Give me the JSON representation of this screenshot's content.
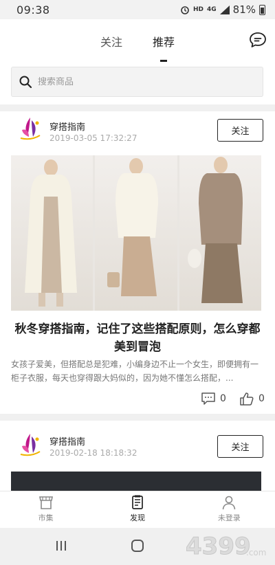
{
  "status_bar": {
    "time": "09:38",
    "network_label": "HD",
    "signal_label": "4G",
    "battery_text": "81%"
  },
  "header": {
    "tabs": [
      {
        "label": "关注",
        "active": false
      },
      {
        "label": "推荐",
        "active": true
      }
    ],
    "message_icon": "chat-bubble-icon"
  },
  "search": {
    "placeholder": "搜索商品"
  },
  "posts": [
    {
      "author": "穿搭指南",
      "timestamp": "2019-03-05 17:32:27",
      "follow_label": "关注",
      "title": "秋冬穿搭指南，记住了这些搭配原则，怎么穿都美到冒泡",
      "excerpt": "女孩子爱美，但搭配总是犯难，小编身边不止一个女生，即便拥有一柜子衣服，每天也穿得跟大妈似的，因为她不懂怎么搭配，...",
      "comments": "0",
      "likes": "0"
    },
    {
      "author": "穿搭指南",
      "timestamp": "2019-02-18 18:18:32",
      "follow_label": "关注"
    }
  ],
  "bottom_nav": [
    {
      "label": "市集",
      "icon": "market-icon",
      "active": false
    },
    {
      "label": "发现",
      "icon": "discover-icon",
      "active": true
    },
    {
      "label": "未登录",
      "icon": "user-icon",
      "active": false
    }
  ],
  "watermark": {
    "text": "4399",
    "suffix": ".com"
  },
  "colors": {
    "accent": "#222222",
    "muted": "#999999",
    "divider": "#f0f0f0"
  }
}
